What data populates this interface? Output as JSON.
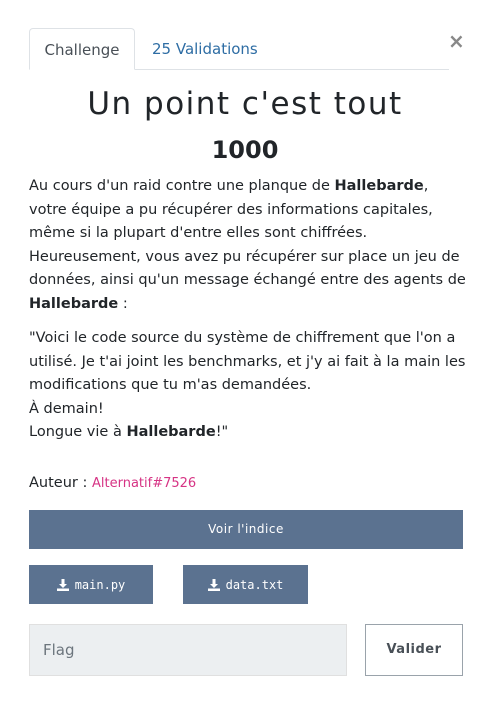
{
  "tabs": [
    {
      "label": "Challenge",
      "active": true
    },
    {
      "label": "25 Validations",
      "active": false
    }
  ],
  "close_symbol": "×",
  "challenge": {
    "title": "Un point c'est tout",
    "points": "1000",
    "description": {
      "p1_a": "Au cours d'un raid contre une planque de ",
      "p1_bold": "Hallebarde",
      "p1_b": ", votre équipe a pu récupérer des informations capitales, même si la plupart d'entre elles sont chiffrées.",
      "p2_a": "Heureusement, vous avez pu récupérer sur place un jeu de données, ainsi qu'un message échangé entre des agents de ",
      "p2_bold": "Hallebarde",
      "p2_b": " :",
      "q1": "\"Voici le code source du système de chiffrement que l'on a utilisé. Je t'ai joint les benchmarks, et j'y ai fait à la main les modifications que tu m'as demandées.",
      "q2": "À demain!",
      "q3_a": "Longue vie à ",
      "q3_bold": "Hallebarde",
      "q3_b": "!\""
    },
    "author_label": "Auteur : ",
    "author_name": "Alternatif#7526"
  },
  "buttons": {
    "hint": "Voir l'indice",
    "file1": "main.py",
    "file2": "data.txt",
    "submit": "Valider"
  },
  "flag_input": {
    "placeholder": "Flag",
    "value": ""
  },
  "icons": {
    "download": "download-icon",
    "close": "close-icon"
  },
  "colors": {
    "button_bg": "#5b7290",
    "link_tab": "#2e6da4",
    "author_link": "#d63384"
  }
}
